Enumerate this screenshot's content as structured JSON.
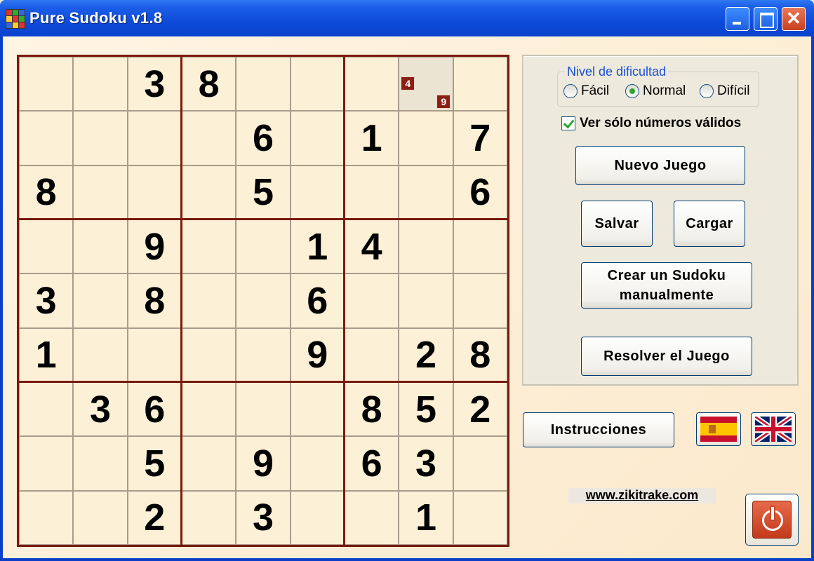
{
  "window": {
    "title": "Pure Sudoku v1.8"
  },
  "board": {
    "grid": [
      [
        "",
        "",
        "3",
        "8",
        "",
        "",
        "",
        "",
        ""
      ],
      [
        "",
        "",
        "",
        "",
        "6",
        "",
        "1",
        "",
        "7"
      ],
      [
        "8",
        "",
        "",
        "",
        "5",
        "",
        "",
        "",
        "6"
      ],
      [
        "",
        "",
        "9",
        "",
        "",
        "1",
        "4",
        "",
        ""
      ],
      [
        "3",
        "",
        "8",
        "",
        "",
        "6",
        "",
        "",
        ""
      ],
      [
        "1",
        "",
        "",
        "",
        "",
        "9",
        "",
        "2",
        "8"
      ],
      [
        "",
        "3",
        "6",
        "",
        "",
        "",
        "8",
        "5",
        "2"
      ],
      [
        "",
        "",
        "5",
        "",
        "9",
        "",
        "6",
        "3",
        ""
      ],
      [
        "",
        "",
        "2",
        "",
        "3",
        "",
        "",
        "1",
        ""
      ]
    ],
    "selected_cell": {
      "row": 0,
      "col": 7
    },
    "candidate_hints": [
      "4",
      "9"
    ]
  },
  "difficulty": {
    "legend": "Nivel de dificultad",
    "options": [
      "Fácil",
      "Normal",
      "Difícil"
    ],
    "selected": "Normal"
  },
  "valid_only_checkbox": {
    "label": "Ver sólo números válidos",
    "checked": true
  },
  "buttons": {
    "new_game": "Nuevo Juego",
    "save": "Salvar",
    "load": "Cargar",
    "create_manual_line1": "Crear un Sudoku",
    "create_manual_line2": "manualmente",
    "solve": "Resolver el Juego",
    "instructions": "Instrucciones"
  },
  "languages": [
    {
      "name": "spanish-flag-icon"
    },
    {
      "name": "uk-flag-icon"
    }
  ],
  "footer": {
    "website": "www.zikitrake.com"
  },
  "colors": {
    "title_bar": "#0d4bd9",
    "board_lines": "#7a1a10",
    "board_bg": "#fcf0d6",
    "accent_green": "#2ea52e"
  }
}
